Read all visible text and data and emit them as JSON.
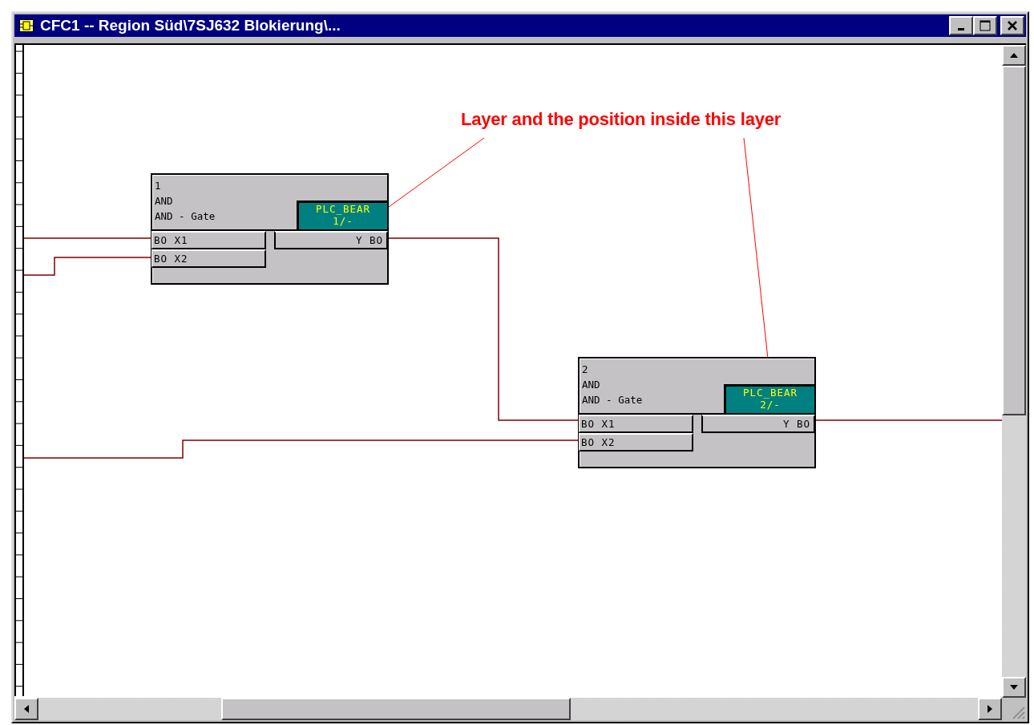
{
  "window": {
    "title": "CFC1 -- Region Süd\\7SJ632 Blokierung\\..."
  },
  "annotation": {
    "text": "Layer and the position inside this layer"
  },
  "blocks": [
    {
      "number": "1",
      "type": "AND",
      "description": "AND - Gate",
      "layer": "PLC_BEAR",
      "position": "1/-",
      "inputs": [
        "BO X1",
        "BO X2"
      ],
      "output": "Y BO"
    },
    {
      "number": "2",
      "type": "AND",
      "description": "AND - Gate",
      "layer": "PLC_BEAR",
      "position": "2/-",
      "inputs": [
        "BO X1",
        "BO X2"
      ],
      "output": "Y BO"
    }
  ]
}
